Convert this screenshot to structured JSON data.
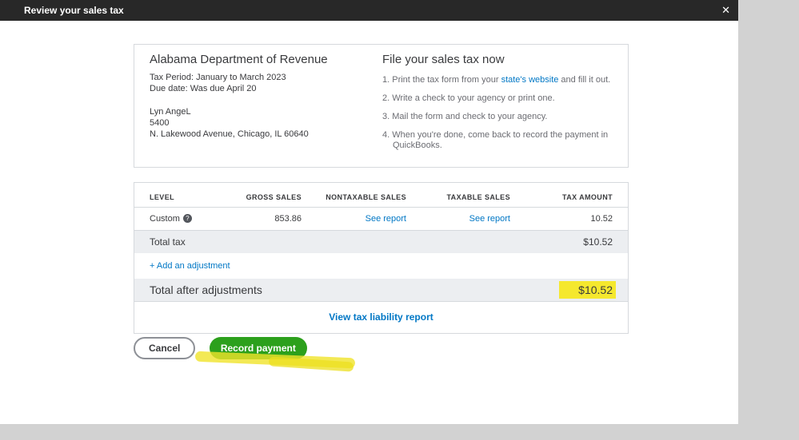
{
  "modal": {
    "title": "Review your sales tax"
  },
  "icons": {
    "close": "✕",
    "help": "?"
  },
  "agency": {
    "name": "Alabama Department of Revenue",
    "tax_period": "Tax Period: January to March 2023",
    "due_date": "Due date:  Was due April 20",
    "contact_name": "Lyn AngeL",
    "address_line1": "5400",
    "address_line2": "N. Lakewood Avenue, Chicago, IL 60640"
  },
  "instructions": {
    "title": "File your sales tax now",
    "steps": [
      {
        "pre": "1. Print the tax form from your ",
        "link": "state's website",
        "post": " and fill it out."
      },
      {
        "pre": "2. Write a check to your agency or print one.",
        "link": "",
        "post": ""
      },
      {
        "pre": "3. Mail the form and check to your agency.",
        "link": "",
        "post": ""
      },
      {
        "pre": "4. When you're done, come back to record the payment in QuickBooks.",
        "link": "",
        "post": ""
      }
    ]
  },
  "table": {
    "headers": [
      "LEVEL",
      "GROSS SALES",
      "NONTAXABLE SALES",
      "TAXABLE SALES",
      "TAX AMOUNT"
    ],
    "row": {
      "level": "Custom",
      "gross_sales": "853.86",
      "nontaxable_sales": "See report",
      "taxable_sales": "See report",
      "tax_amount": "10.52"
    },
    "total_tax_label": "Total tax",
    "total_tax_value": "$10.52",
    "add_adjustment_label": "+ Add an adjustment",
    "total_after_label": "Total after adjustments",
    "total_after_value": "$10.52",
    "view_report_label": "View tax liability report"
  },
  "actions": {
    "cancel_label": "Cancel",
    "record_payment_label": "Record payment"
  },
  "colors": {
    "titlebar_dark": "#282828",
    "accent_green": "#2ca01c",
    "link_blue": "#0077c5",
    "highlight_yellow": "#f0e42a",
    "total_row_gray": "#eceef1"
  }
}
